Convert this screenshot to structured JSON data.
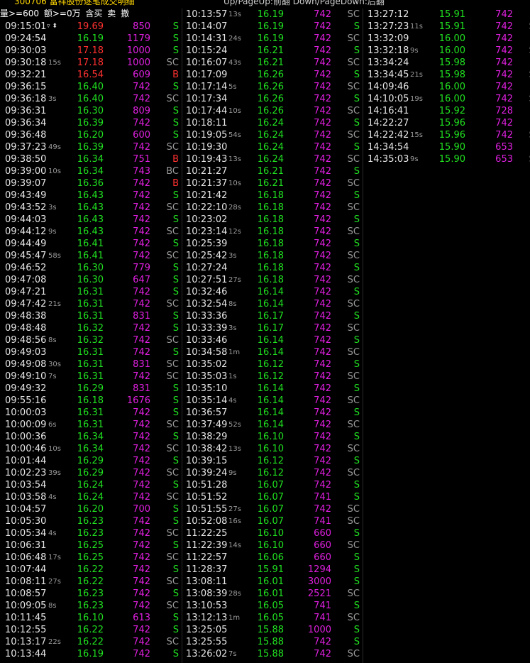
{
  "top_bar": {
    "left_text": "300706 富祥股份逐笔成交明细",
    "right_text": "Up/PageUp:前翻 Down/PageDown:后翻",
    "title_color": "#ffd700"
  },
  "filter_bar": {
    "volume_filter": "量>=600",
    "amount_filter": "额>=0万",
    "options": [
      "含买",
      "卖",
      "撤"
    ]
  },
  "colors": {
    "up": "#ff3030",
    "down": "#20e020",
    "volume": "#e020e0",
    "text": "#e6e6e6"
  },
  "columns": [
    [
      [
        "09:15:01",
        "",
        "19.69",
        "850",
        "S",
        "u"
      ],
      [
        "09:24:54",
        "",
        "16.19",
        "1179",
        "S",
        "d"
      ],
      [
        "09:30:03",
        "",
        "17.18",
        "1000",
        "S",
        "u"
      ],
      [
        "09:30:18",
        "15s",
        "17.18",
        "1000",
        "SC",
        "u"
      ],
      [
        "09:32:21",
        "",
        "16.54",
        "609",
        "B",
        "u"
      ],
      [
        "09:36:15",
        "",
        "16.40",
        "742",
        "S",
        "d"
      ],
      [
        "09:36:18",
        "3s",
        "16.40",
        "742",
        "SC",
        "d"
      ],
      [
        "09:36:31",
        "",
        "16.30",
        "809",
        "S",
        "d"
      ],
      [
        "09:36:34",
        "",
        "16.39",
        "742",
        "S",
        "d"
      ],
      [
        "09:36:48",
        "",
        "16.20",
        "600",
        "S",
        "d"
      ],
      [
        "09:37:23",
        "49s",
        "16.39",
        "742",
        "SC",
        "d"
      ],
      [
        "09:38:50",
        "",
        "16.34",
        "751",
        "B",
        "d"
      ],
      [
        "09:39:00",
        "10s",
        "16.34",
        "743",
        "BC",
        "d"
      ],
      [
        "09:39:07",
        "",
        "16.36",
        "742",
        "B",
        "d"
      ],
      [
        "09:43:49",
        "",
        "16.43",
        "742",
        "S",
        "d"
      ],
      [
        "09:43:52",
        "3s",
        "16.43",
        "742",
        "SC",
        "d"
      ],
      [
        "09:44:03",
        "",
        "16.43",
        "742",
        "S",
        "d"
      ],
      [
        "09:44:12",
        "9s",
        "16.43",
        "742",
        "SC",
        "d"
      ],
      [
        "09:44:49",
        "",
        "16.41",
        "742",
        "S",
        "d"
      ],
      [
        "09:45:47",
        "58s",
        "16.41",
        "742",
        "SC",
        "d"
      ],
      [
        "09:46:52",
        "",
        "16.30",
        "779",
        "S",
        "d"
      ],
      [
        "09:47:08",
        "",
        "16.30",
        "647",
        "S",
        "d"
      ],
      [
        "09:47:21",
        "",
        "16.31",
        "742",
        "S",
        "d"
      ],
      [
        "09:47:42",
        "21s",
        "16.31",
        "742",
        "SC",
        "d"
      ],
      [
        "09:48:38",
        "",
        "16.31",
        "831",
        "S",
        "d"
      ],
      [
        "09:48:48",
        "",
        "16.32",
        "742",
        "S",
        "d"
      ],
      [
        "09:48:56",
        "8s",
        "16.32",
        "742",
        "SC",
        "d"
      ],
      [
        "09:49:03",
        "",
        "16.31",
        "742",
        "S",
        "d"
      ],
      [
        "09:49:08",
        "30s",
        "16.31",
        "831",
        "SC",
        "d"
      ],
      [
        "09:49:10",
        "7s",
        "16.31",
        "742",
        "SC",
        "d"
      ],
      [
        "09:49:32",
        "",
        "16.29",
        "831",
        "S",
        "d"
      ],
      [
        "09:55:16",
        "",
        "16.18",
        "1676",
        "S",
        "d"
      ],
      [
        "10:00:03",
        "",
        "16.31",
        "742",
        "S",
        "d"
      ],
      [
        "10:00:09",
        "6s",
        "16.31",
        "742",
        "SC",
        "d"
      ],
      [
        "10:00:36",
        "",
        "16.34",
        "742",
        "S",
        "d"
      ],
      [
        "10:00:46",
        "10s",
        "16.34",
        "742",
        "SC",
        "d"
      ],
      [
        "10:01:44",
        "",
        "16.29",
        "742",
        "S",
        "d"
      ],
      [
        "10:02:23",
        "39s",
        "16.29",
        "742",
        "SC",
        "d"
      ],
      [
        "10:03:54",
        "",
        "16.24",
        "742",
        "S",
        "d"
      ],
      [
        "10:03:58",
        "4s",
        "16.24",
        "742",
        "SC",
        "d"
      ],
      [
        "10:04:57",
        "",
        "16.20",
        "700",
        "S",
        "d"
      ],
      [
        "10:05:30",
        "",
        "16.23",
        "742",
        "S",
        "d"
      ],
      [
        "10:05:34",
        "4s",
        "16.23",
        "742",
        "SC",
        "d"
      ],
      [
        "10:06:31",
        "",
        "16.25",
        "742",
        "S",
        "d"
      ],
      [
        "10:06:48",
        "17s",
        "16.25",
        "742",
        "SC",
        "d"
      ],
      [
        "10:07:44",
        "",
        "16.22",
        "742",
        "S",
        "d"
      ],
      [
        "10:08:11",
        "27s",
        "16.22",
        "742",
        "SC",
        "d"
      ],
      [
        "10:08:57",
        "",
        "16.23",
        "742",
        "S",
        "d"
      ],
      [
        "10:09:05",
        "8s",
        "16.23",
        "742",
        "SC",
        "d"
      ],
      [
        "10:11:45",
        "",
        "16.10",
        "613",
        "S",
        "d"
      ],
      [
        "10:12:55",
        "",
        "16.22",
        "742",
        "S",
        "d"
      ],
      [
        "10:13:17",
        "22s",
        "16.22",
        "742",
        "SC",
        "d"
      ],
      [
        "10:13:44",
        "",
        "16.19",
        "742",
        "S",
        "d"
      ]
    ],
    [
      [
        "10:13:57",
        "13s",
        "16.19",
        "742",
        "SC",
        "d"
      ],
      [
        "10:14:07",
        "",
        "16.19",
        "742",
        "S",
        "d"
      ],
      [
        "10:14:31",
        "24s",
        "16.19",
        "742",
        "SC",
        "d"
      ],
      [
        "10:15:24",
        "",
        "16.21",
        "742",
        "S",
        "d"
      ],
      [
        "10:16:07",
        "43s",
        "16.21",
        "742",
        "SC",
        "d"
      ],
      [
        "10:17:09",
        "",
        "16.26",
        "742",
        "S",
        "d"
      ],
      [
        "10:17:14",
        "5s",
        "16.26",
        "742",
        "SC",
        "d"
      ],
      [
        "10:17:34",
        "",
        "16.26",
        "742",
        "S",
        "d"
      ],
      [
        "10:17:44",
        "10s",
        "16.26",
        "742",
        "SC",
        "d"
      ],
      [
        "10:18:11",
        "",
        "16.24",
        "742",
        "S",
        "d"
      ],
      [
        "10:19:05",
        "54s",
        "16.24",
        "742",
        "SC",
        "d"
      ],
      [
        "10:19:30",
        "",
        "16.24",
        "742",
        "S",
        "d"
      ],
      [
        "10:19:43",
        "13s",
        "16.24",
        "742",
        "SC",
        "d"
      ],
      [
        "10:21:27",
        "",
        "16.21",
        "742",
        "S",
        "d"
      ],
      [
        "10:21:37",
        "10s",
        "16.21",
        "742",
        "SC",
        "d"
      ],
      [
        "10:21:42",
        "",
        "16.18",
        "742",
        "S",
        "d"
      ],
      [
        "10:22:10",
        "28s",
        "16.18",
        "742",
        "SC",
        "d"
      ],
      [
        "10:23:02",
        "",
        "16.18",
        "742",
        "S",
        "d"
      ],
      [
        "10:23:14",
        "12s",
        "16.18",
        "742",
        "SC",
        "d"
      ],
      [
        "10:25:39",
        "",
        "16.18",
        "742",
        "S",
        "d"
      ],
      [
        "10:25:42",
        "3s",
        "16.18",
        "742",
        "SC",
        "d"
      ],
      [
        "10:27:24",
        "",
        "16.18",
        "742",
        "S",
        "d"
      ],
      [
        "10:27:51",
        "27s",
        "16.18",
        "742",
        "SC",
        "d"
      ],
      [
        "10:32:46",
        "",
        "16.14",
        "742",
        "S",
        "d"
      ],
      [
        "10:32:54",
        "8s",
        "16.14",
        "742",
        "SC",
        "d"
      ],
      [
        "10:33:36",
        "",
        "16.17",
        "742",
        "S",
        "d"
      ],
      [
        "10:33:39",
        "3s",
        "16.17",
        "742",
        "SC",
        "d"
      ],
      [
        "10:33:46",
        "",
        "16.14",
        "742",
        "S",
        "d"
      ],
      [
        "10:34:58",
        "1m",
        "16.14",
        "742",
        "SC",
        "d"
      ],
      [
        "10:35:02",
        "",
        "16.12",
        "742",
        "S",
        "d"
      ],
      [
        "10:35:03",
        "1s",
        "16.12",
        "742",
        "SC",
        "d"
      ],
      [
        "10:35:10",
        "",
        "16.14",
        "742",
        "S",
        "d"
      ],
      [
        "10:35:14",
        "4s",
        "16.14",
        "742",
        "SC",
        "d"
      ],
      [
        "10:36:57",
        "",
        "16.14",
        "742",
        "S",
        "d"
      ],
      [
        "10:37:49",
        "52s",
        "16.14",
        "742",
        "SC",
        "d"
      ],
      [
        "10:38:29",
        "",
        "16.10",
        "742",
        "S",
        "d"
      ],
      [
        "10:38:42",
        "13s",
        "16.10",
        "742",
        "SC",
        "d"
      ],
      [
        "10:39:15",
        "",
        "16.12",
        "742",
        "S",
        "d"
      ],
      [
        "10:39:24",
        "9s",
        "16.12",
        "742",
        "SC",
        "d"
      ],
      [
        "10:51:28",
        "",
        "16.07",
        "742",
        "S",
        "d"
      ],
      [
        "10:51:52",
        "",
        "16.07",
        "741",
        "S",
        "d"
      ],
      [
        "10:51:55",
        "27s",
        "16.07",
        "742",
        "SC",
        "d"
      ],
      [
        "10:52:08",
        "16s",
        "16.07",
        "741",
        "SC",
        "d"
      ],
      [
        "11:22:25",
        "",
        "16.10",
        "660",
        "S",
        "d"
      ],
      [
        "11:22:39",
        "14s",
        "16.10",
        "660",
        "SC",
        "d"
      ],
      [
        "11:22:57",
        "",
        "16.06",
        "660",
        "S",
        "d"
      ],
      [
        "11:28:37",
        "",
        "15.91",
        "1294",
        "S",
        "d"
      ],
      [
        "13:08:11",
        "",
        "16.01",
        "3000",
        "S",
        "d"
      ],
      [
        "13:08:39",
        "28s",
        "16.01",
        "2521",
        "SC",
        "d"
      ],
      [
        "13:10:53",
        "",
        "16.05",
        "741",
        "S",
        "d"
      ],
      [
        "13:12:13",
        "1m",
        "16.05",
        "741",
        "SC",
        "d"
      ],
      [
        "13:25:05",
        "",
        "15.88",
        "1000",
        "S",
        "d"
      ],
      [
        "13:25:55",
        "",
        "15.88",
        "742",
        "S",
        "d"
      ],
      [
        "13:26:02",
        "7s",
        "15.88",
        "742",
        "SC",
        "d"
      ]
    ],
    [
      [
        "13:27:12",
        "",
        "15.91",
        "742",
        "S",
        "d"
      ],
      [
        "13:27:23",
        "11s",
        "15.91",
        "742",
        "SC",
        "d"
      ],
      [
        "13:32:09",
        "",
        "16.00",
        "742",
        "S",
        "d"
      ],
      [
        "13:32:18",
        "9s",
        "16.00",
        "742",
        "SC",
        "d"
      ],
      [
        "13:34:24",
        "",
        "15.98",
        "742",
        "S",
        "d"
      ],
      [
        "13:34:45",
        "21s",
        "15.98",
        "742",
        "SC",
        "d"
      ],
      [
        "14:09:46",
        "",
        "16.00",
        "742",
        "S",
        "d"
      ],
      [
        "14:10:05",
        "19s",
        "16.00",
        "742",
        "SC",
        "d"
      ],
      [
        "14:16:41",
        "",
        "15.92",
        "728",
        "S",
        "d"
      ],
      [
        "14:22:27",
        "",
        "15.96",
        "742",
        "S",
        "d"
      ],
      [
        "14:22:42",
        "15s",
        "15.96",
        "742",
        "SC",
        "d"
      ],
      [
        "14:34:54",
        "",
        "15.90",
        "653",
        "S",
        "d"
      ],
      [
        "14:35:03",
        "9s",
        "15.90",
        "653",
        "SC",
        "d"
      ]
    ]
  ]
}
